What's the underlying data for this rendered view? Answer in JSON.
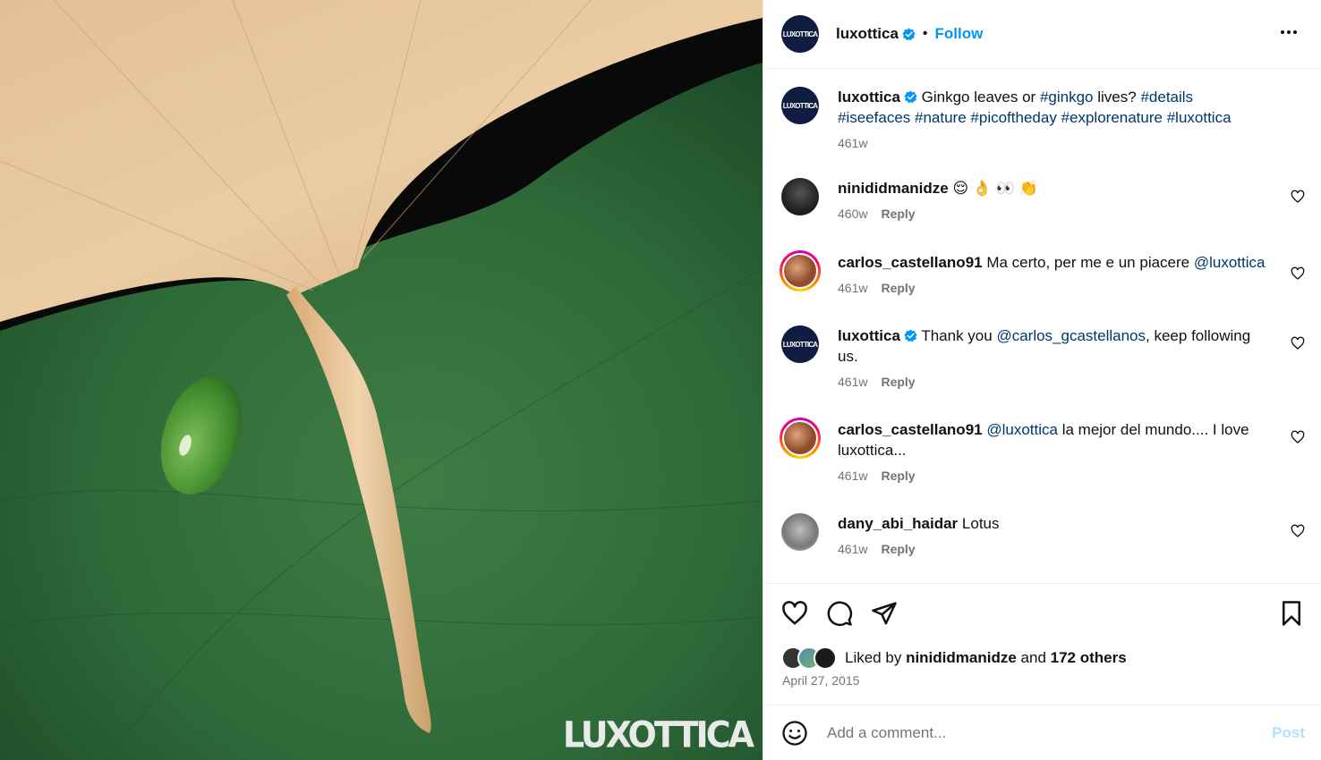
{
  "image": {
    "watermark": "LUXOTTICA"
  },
  "header": {
    "avatar_text": "LUXOTTICA",
    "username": "luxottica",
    "separator": "•",
    "follow_label": "Follow"
  },
  "caption": {
    "username": "luxottica",
    "text": "Ginkgo leaves or",
    "tags": [
      "#ginkgo",
      "#details",
      "#iseefaces",
      "#nature",
      "#picoftheday",
      "#explorenature",
      "#luxottica"
    ],
    "mid_text": "lives?",
    "time": "461w"
  },
  "comments": [
    {
      "username": "nini_didmanidze",
      "display": "ninididmanidze",
      "text": "😌 👌 👀 👏",
      "time": "460w",
      "reply": "Reply"
    },
    {
      "username": "carlos_castellano91",
      "text": "Ma certo, per me e un piacere",
      "mention": "@luxottica",
      "time": "461w",
      "reply": "Reply"
    },
    {
      "username": "luxottica",
      "text_before": "Thank you",
      "mention": "@carlos_gcastellanos",
      "text_after": ", keep following us.",
      "time": "461w",
      "reply": "Reply"
    },
    {
      "username": "carlos_castellano91",
      "mention": "@luxottica",
      "text": "la mejor del mundo.... I love luxottica...",
      "time": "461w",
      "reply": "Reply"
    },
    {
      "username": "dany_abi_haidar",
      "text": "Lotus",
      "time": "461w",
      "reply": "Reply"
    }
  ],
  "likes": {
    "prefix": "Liked by",
    "user": "ninididmanidze",
    "and": "and",
    "others": "172 others"
  },
  "date": "April 27, 2015",
  "add_comment": {
    "placeholder": "Add a comment...",
    "post_label": "Post"
  },
  "colors": {
    "link": "#00376b",
    "follow": "#0095f6",
    "muted": "#737373",
    "brand_avatar": "#0e1d40"
  }
}
